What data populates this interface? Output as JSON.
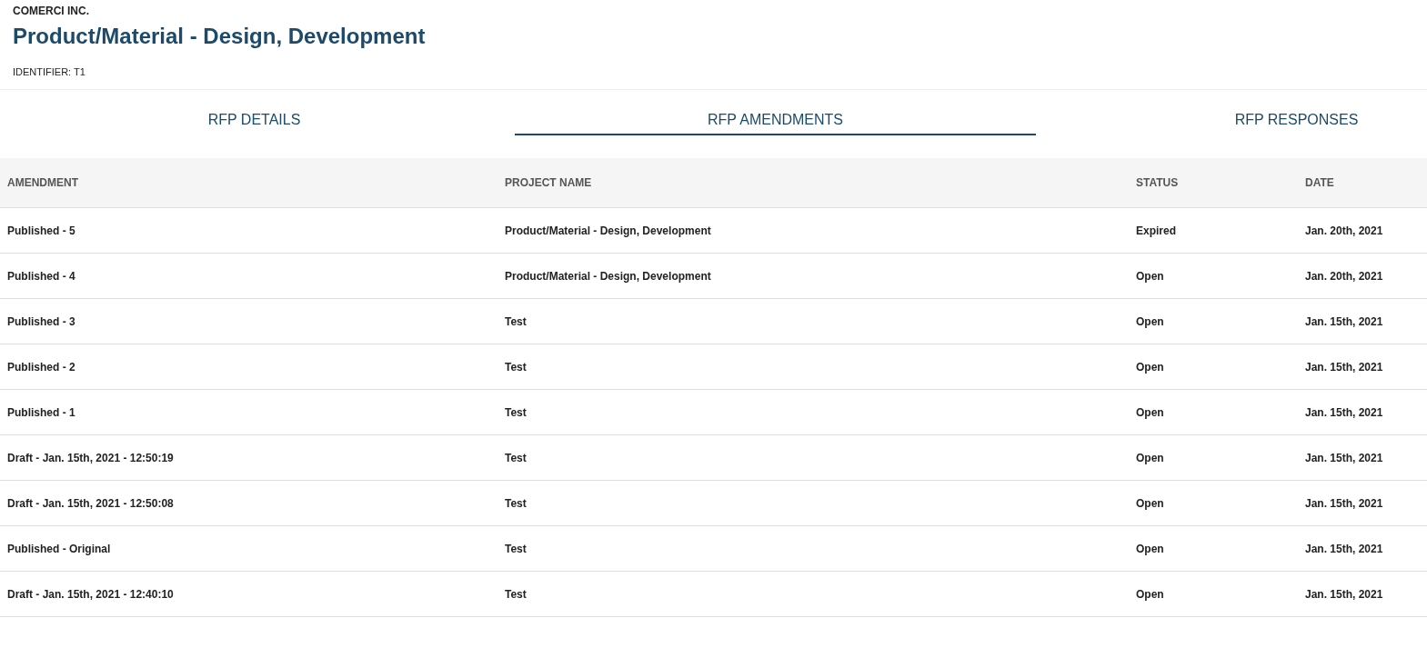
{
  "header": {
    "company": "COMERCI INC.",
    "title": "Product/Material - Design, Development",
    "identifier": "IDENTIFIER: T1"
  },
  "tabs": [
    {
      "label": "RFP DETAILS",
      "selected": false
    },
    {
      "label": "RFP AMENDMENTS",
      "selected": true
    },
    {
      "label": "RFP RESPONSES",
      "selected": false
    }
  ],
  "table": {
    "columns": [
      "AMENDMENT",
      "PROJECT NAME",
      "STATUS",
      "DATE"
    ],
    "rows": [
      [
        "Published - 5",
        "Product/Material - Design, Development",
        "Expired",
        "Jan. 20th, 2021"
      ],
      [
        "Published - 4",
        "Product/Material - Design, Development",
        "Open",
        "Jan. 20th, 2021"
      ],
      [
        "Published - 3",
        "Test",
        "Open",
        "Jan. 15th, 2021"
      ],
      [
        "Published - 2",
        "Test",
        "Open",
        "Jan. 15th, 2021"
      ],
      [
        "Published - 1",
        "Test",
        "Open",
        "Jan. 15th, 2021"
      ],
      [
        "Draft - Jan. 15th, 2021 - 12:50:19",
        "Test",
        "Open",
        "Jan. 15th, 2021"
      ],
      [
        "Draft - Jan. 15th, 2021 - 12:50:08",
        "Test",
        "Open",
        "Jan. 15th, 2021"
      ],
      [
        "Published - Original",
        "Test",
        "Open",
        "Jan. 15th, 2021"
      ],
      [
        "Draft - Jan. 15th, 2021 - 12:40:10",
        "Test",
        "Open",
        "Jan. 15th, 2021"
      ]
    ]
  }
}
